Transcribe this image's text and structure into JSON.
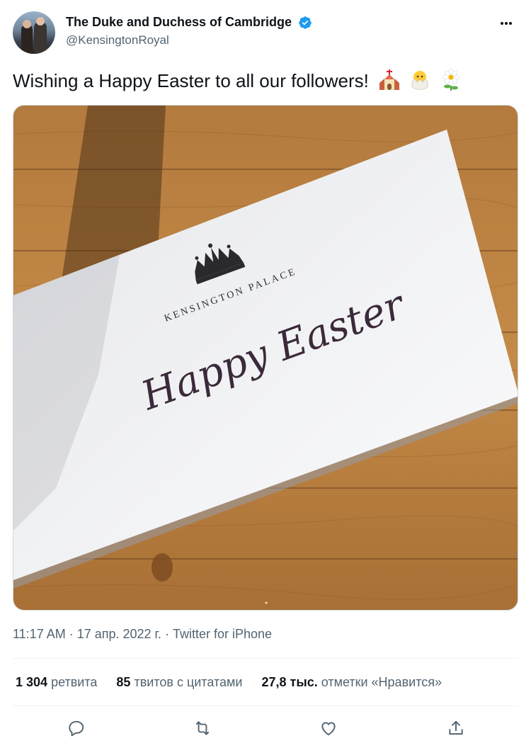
{
  "author": {
    "display_name": "The Duke and Duchess of Cambridge",
    "handle": "@KensingtonRoyal"
  },
  "tweet": {
    "text": "Wishing a Happy Easter to all our followers!",
    "emojis": [
      "church-emoji",
      "hatching-chick-emoji",
      "daisy-emoji"
    ]
  },
  "media": {
    "card_heading": "KENSINGTON PALACE",
    "card_script": "Happy Easter"
  },
  "meta": {
    "time": "11:17 AM",
    "date": "17 апр. 2022 г.",
    "source": "Twitter for iPhone",
    "separator": " · "
  },
  "stats": {
    "retweets": {
      "count": "1 304",
      "label": "ретвита"
    },
    "quotes": {
      "count": "85",
      "label": "твитов с цитатами"
    },
    "likes": {
      "count": "27,8 тыс.",
      "label": "отметки «Нравится»"
    }
  },
  "colors": {
    "text": "#0f1419",
    "secondary": "#536471",
    "verified": "#1d9bf0",
    "divider": "#eff3f4"
  },
  "icons": [
    "verified-badge-icon",
    "more-icon",
    "reply-icon",
    "retweet-icon",
    "like-icon",
    "share-icon"
  ]
}
